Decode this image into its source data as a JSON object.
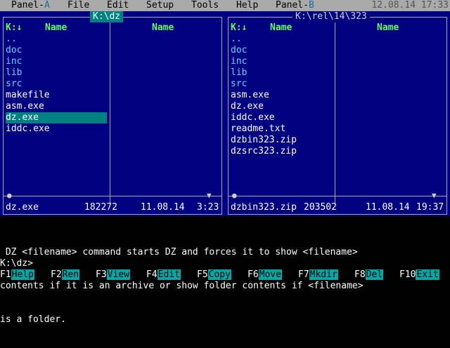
{
  "menubar": {
    "items": [
      {
        "pre": "Panel-",
        "hl": "A"
      },
      {
        "pre": "File",
        "hl": ""
      },
      {
        "pre": "Edit",
        "hl": ""
      },
      {
        "pre": "Setup",
        "hl": ""
      },
      {
        "pre": "Tools",
        "hl": ""
      },
      {
        "pre": "Help",
        "hl": ""
      },
      {
        "pre": "Panel-",
        "hl": "B"
      }
    ],
    "clock": "12.08.14 17:33"
  },
  "panel_a": {
    "title": "K:\\dz",
    "col1_header": "K:↓",
    "col1_name": "Name",
    "col2_name": "Name",
    "files": [
      {
        "name": "..",
        "type": "dir"
      },
      {
        "name": "doc",
        "type": "dir"
      },
      {
        "name": "inc",
        "type": "dir"
      },
      {
        "name": "lib",
        "type": "dir"
      },
      {
        "name": "src",
        "type": "dir"
      },
      {
        "name": "makefile",
        "type": "file"
      },
      {
        "name": "asm.exe",
        "type": "file"
      },
      {
        "name": "dz.exe",
        "type": "file",
        "selected": true
      },
      {
        "name": "iddc.exe",
        "type": "file"
      }
    ],
    "status": {
      "name": "dz.exe",
      "size": "182272",
      "date": "11.08.14",
      "time": "3:23"
    }
  },
  "panel_b": {
    "title": "K:\\rel\\14\\323",
    "col1_header": "K:↓",
    "col1_name": "Name",
    "col2_name": "Name",
    "files": [
      {
        "name": "..",
        "type": "dir"
      },
      {
        "name": "doc",
        "type": "dir"
      },
      {
        "name": "inc",
        "type": "dir"
      },
      {
        "name": "lib",
        "type": "dir"
      },
      {
        "name": "src",
        "type": "dir"
      },
      {
        "name": "asm.exe",
        "type": "file"
      },
      {
        "name": "dz.exe",
        "type": "file"
      },
      {
        "name": "iddc.exe",
        "type": "file"
      },
      {
        "name": "readme.txt",
        "type": "file"
      },
      {
        "name": "dzbin323.zip",
        "type": "file"
      },
      {
        "name": "dzsrc323.zip",
        "type": "file"
      }
    ],
    "status": {
      "name": "dzbin323.zip",
      "size": "203502",
      "date": "11.08.14",
      "time": "19:37"
    }
  },
  "info": {
    "line1": " DZ <filename> command starts DZ and forces it to show <filename>",
    "line2": "contents if it is an archive or show folder contents if <filename>",
    "line3": "is a folder."
  },
  "prompt": "K:\\dz>",
  "fkeys": [
    {
      "num": "F1",
      "label": "Help"
    },
    {
      "num": "F2",
      "label": "Ren"
    },
    {
      "num": "F3",
      "label": "View"
    },
    {
      "num": "F4",
      "label": "Edit"
    },
    {
      "num": "F5",
      "label": "Copy"
    },
    {
      "num": "F6",
      "label": "Move"
    },
    {
      "num": "F7",
      "label": "Mkdir"
    },
    {
      "num": "F8",
      "label": "Del"
    },
    {
      "num": "F10",
      "label": "Exit"
    }
  ]
}
